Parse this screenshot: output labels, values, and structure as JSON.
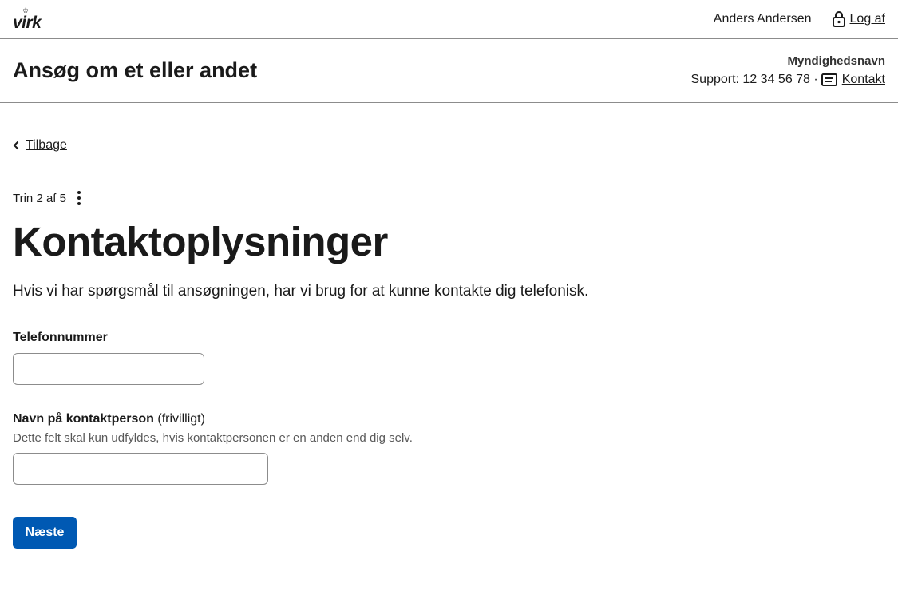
{
  "topbar": {
    "logo": "virk",
    "user_name": "Anders Andersen",
    "logout_label": "Log af"
  },
  "header": {
    "title": "Ansøg om et eller andet",
    "authority": "Myndighedsnavn",
    "support": "Support: 12 34 56 78 ·",
    "contact_label": "Kontakt"
  },
  "back_label": "Tilbage",
  "step": "Trin 2 af 5",
  "page_title": "Kontaktoplysninger",
  "intro": "Hvis vi har spørgsmål til ansøgningen, har vi brug for at kunne kontakte dig telefonisk.",
  "fields": {
    "phone": {
      "label": "Telefonnummer",
      "value": ""
    },
    "contact": {
      "label": "Navn på kontaktperson",
      "optional": "(frivilligt)",
      "hint": "Dette felt skal kun udfyldes, hvis kontaktpersonen er en anden end dig selv.",
      "value": ""
    }
  },
  "next_label": "Næste",
  "colors": {
    "primary": "#0059b3",
    "border": "#8c8c8c",
    "hint": "#595959"
  },
  "icons": [
    "lock-icon",
    "contact-card-icon",
    "chevron-left-icon",
    "more-vertical-icon"
  ]
}
